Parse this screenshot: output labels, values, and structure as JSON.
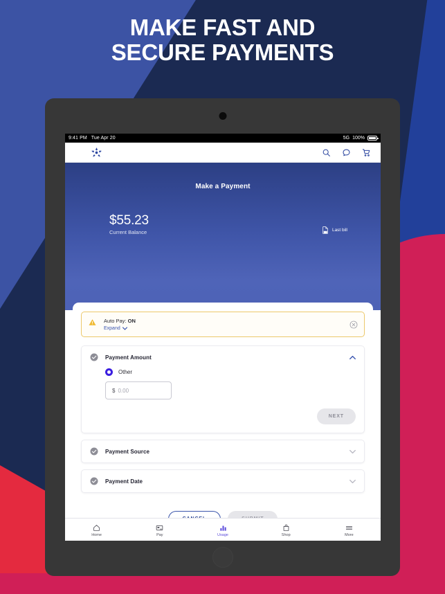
{
  "promo": {
    "headline_line1": "MAKE FAST AND",
    "headline_line2": "SECURE PAYMENTS",
    "bg_navy": "#1b2a52",
    "bg_blue": "#3c53a4",
    "bg_royal": "#22409a",
    "bg_crimson": "#d01f57",
    "bg_red": "#e42a3f"
  },
  "status_bar": {
    "time": "9:41 PM",
    "date": "Tue Apr 20",
    "network": "5G",
    "battery": "100%"
  },
  "appbar": {
    "logo": "star-logo",
    "actions": [
      {
        "name": "search-icon",
        "label": "Search"
      },
      {
        "name": "chat-icon",
        "label": "Chat"
      },
      {
        "name": "cart-icon",
        "label": "Cart"
      }
    ]
  },
  "hero": {
    "title": "Make a Payment",
    "balance_amount": "$55.23",
    "balance_label": "Current Balance",
    "last_bill_label": "Last bill",
    "last_bill_icon": "pdf-document-icon"
  },
  "autopay": {
    "prefix": "Auto Pay: ",
    "state": "ON",
    "expand_label": "Expand",
    "dismiss_icon": "close-circle-icon",
    "warn_icon": "warning-triangle-icon",
    "border_color": "#ecc86a"
  },
  "sections": [
    {
      "title": "Payment Amount",
      "expanded": true,
      "option_label": "Other",
      "option_selected": true,
      "currency_symbol": "$",
      "amount_value": "",
      "amount_placeholder": "0.00",
      "next_label": "NEXT"
    },
    {
      "title": "Payment Source",
      "expanded": false
    },
    {
      "title": "Payment Date",
      "expanded": false
    }
  ],
  "footer": {
    "cancel_label": "CANCEL",
    "submit_label": "SUBMIT",
    "accent": "#3b55ab"
  },
  "tabbar": {
    "active_color": "#5b4bdb",
    "items": [
      {
        "label": "Home",
        "icon": "home-icon",
        "active": false
      },
      {
        "label": "Pay",
        "icon": "pay-card-icon",
        "active": false
      },
      {
        "label": "Usage",
        "icon": "usage-bars-icon",
        "active": true
      },
      {
        "label": "Shop",
        "icon": "shop-bag-icon",
        "active": false
      },
      {
        "label": "More",
        "icon": "more-menu-icon",
        "active": false
      }
    ]
  }
}
